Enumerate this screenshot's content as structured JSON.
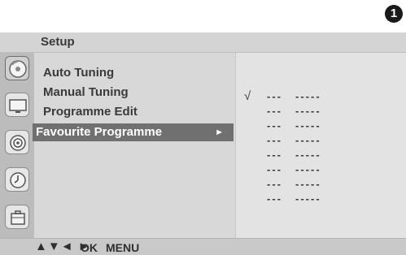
{
  "step_badge": "1",
  "header": {
    "title": "Setup"
  },
  "side_rail": {
    "icons": [
      {
        "name": "setup-disc-icon",
        "active": true
      },
      {
        "name": "picture-screen-icon",
        "active": false
      },
      {
        "name": "audio-speaker-icon",
        "active": false
      },
      {
        "name": "time-clock-icon",
        "active": false
      },
      {
        "name": "option-toolbox-icon",
        "active": false
      }
    ]
  },
  "menu": {
    "items": [
      {
        "label": "Auto Tuning"
      },
      {
        "label": "Manual Tuning"
      },
      {
        "label": "Programme Edit"
      },
      {
        "label": "Favourite Programme",
        "selected": true
      }
    ],
    "selected_arrow": "►"
  },
  "favourites": {
    "check_mark": "√",
    "rows": [
      {
        "number": "---",
        "name": "-----"
      },
      {
        "number": "---",
        "name": "-----"
      },
      {
        "number": "---",
        "name": "-----"
      },
      {
        "number": "---",
        "name": "-----"
      },
      {
        "number": "---",
        "name": "-----"
      },
      {
        "number": "---",
        "name": "-----"
      },
      {
        "number": "---",
        "name": "-----"
      },
      {
        "number": "---",
        "name": "-----"
      }
    ]
  },
  "footer": {
    "nav_arrows": "▲▼◄ ►",
    "ok_label": "OK",
    "menu_label": "MENU"
  }
}
